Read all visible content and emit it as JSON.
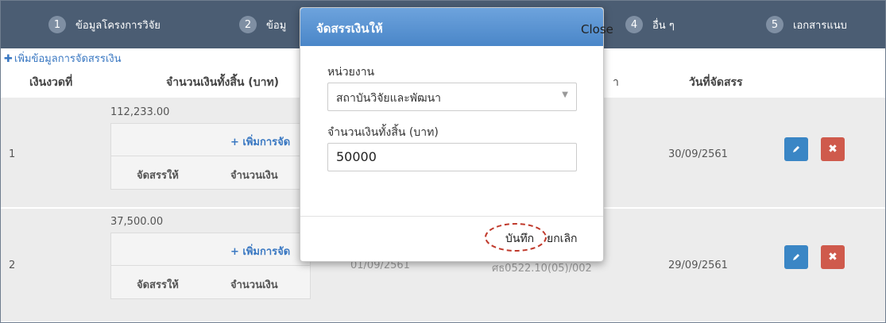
{
  "steps": [
    {
      "num": "1",
      "label": "ข้อมูลโครงการวิจัย"
    },
    {
      "num": "2",
      "label": "ข้อมู"
    },
    {
      "num": "4",
      "label": "อื่น ๆ"
    },
    {
      "num": "5",
      "label": "เอกสารแนบ"
    }
  ],
  "add_allocation_link": "เพิ่มข้อมูลการจัดสรรเงิน",
  "table": {
    "headers": {
      "installment": "เงินงวดที่",
      "total_amount": "จำนวนเงินทั้งสิ้น (บาท)",
      "partial_ref": "า",
      "allocation_date": "วันที่จัดสรร"
    },
    "rows": [
      {
        "index": "1",
        "total": "112,233.00",
        "add_sub": "+ เพิ่มการจัด",
        "sub_col1": "จัดสรรให้",
        "sub_col2": "จำนวนเงิน",
        "date": "30/09/2561"
      },
      {
        "index": "2",
        "total": "37,500.00",
        "add_sub": "+ เพิ่มการจัด",
        "sub_col1": "จัดสรรให้",
        "sub_col2": "จำนวนเงิน",
        "partial_date": "01/09/2561",
        "partial_ref": "ศธ0522.10(05)/002",
        "date": "29/09/2561"
      }
    ]
  },
  "modal": {
    "title": "จัดสรรเงินให้",
    "close_label": "Close",
    "unit_label": "หน่วยงาน",
    "unit_value": "สถาบันวิจัยและพัฒนา",
    "amount_label": "จำนวนเงินทั้งสิ้น (บาท)",
    "amount_value": "50000",
    "save_label": "บันทึก",
    "cancel_label": "ยกเลิก"
  },
  "icons": {
    "edit": "pencil-icon",
    "delete": "close-icon",
    "select": "chevron-down-icon"
  },
  "colors": {
    "header_bar": "#4b5d73",
    "modal_header": "#4a86c8",
    "edit_button": "#3a86c5",
    "delete_button": "#cf5a4c",
    "link": "#3a78c2",
    "highlight_ring": "#c0392b"
  }
}
